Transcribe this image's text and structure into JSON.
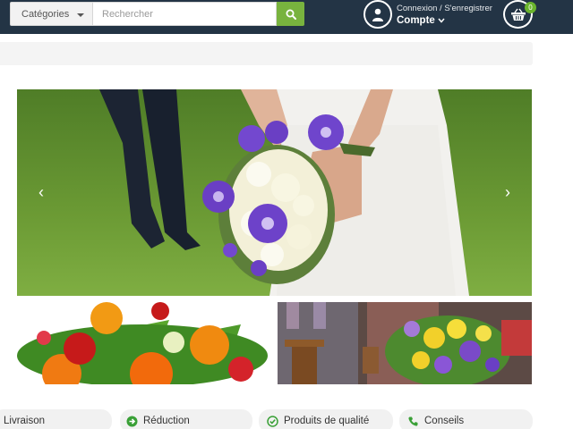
{
  "header": {
    "categories_label": "Catégories",
    "search_placeholder": "Rechercher",
    "account_line1": "Connexion / S'enregistrer",
    "account_line2": "Compte",
    "cart_count": "0"
  },
  "slider": {
    "prev_glyph": "‹",
    "next_glyph": "›"
  },
  "features": [
    {
      "label": "Livraison",
      "icon": "truck-icon"
    },
    {
      "label": "Réduction",
      "icon": "arrow-circle-right-icon"
    },
    {
      "label": "Produits de qualité",
      "icon": "check-circle-icon"
    },
    {
      "label": "Conseils",
      "icon": "phone-icon"
    }
  ],
  "colors": {
    "header_bg": "#233445",
    "accent_green": "#78b33e",
    "badge_green": "#6ab42d"
  }
}
